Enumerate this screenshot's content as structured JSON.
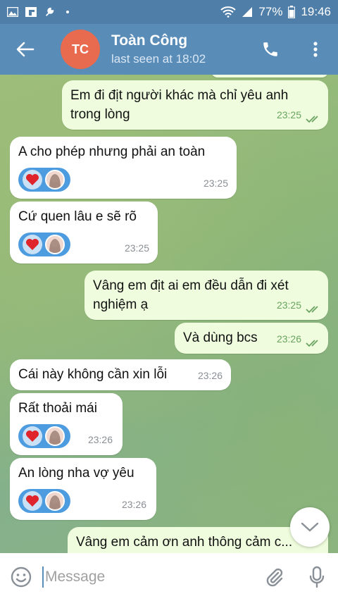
{
  "status_bar": {
    "battery_percent": "77%",
    "time": "19:46"
  },
  "header": {
    "avatar_initials": "TC",
    "contact_name": "Toàn Công",
    "last_seen": "last seen at 18:02"
  },
  "messages": [
    {
      "dir": "out",
      "text_lines": [
        "Em đi địt người khác mà chỉ yêu anh",
        "trong lòng"
      ],
      "time": "23:25"
    },
    {
      "dir": "in",
      "text_lines": [
        "A cho phép nhưng phải an toàn"
      ],
      "time": "23:25",
      "reaction": "heart"
    },
    {
      "dir": "in",
      "text_lines": [
        "Cứ quen lâu e sẽ rõ"
      ],
      "time": "23:25",
      "reaction": "heart"
    },
    {
      "dir": "out",
      "text_lines": [
        "Vâng em địt ai em đều dẫn đi xét",
        "nghiệm ạ"
      ],
      "time": "23:25"
    },
    {
      "dir": "out",
      "text_lines": [
        "Và dùng bcs"
      ],
      "time": "23:26"
    },
    {
      "dir": "in",
      "text_lines": [
        "Cái này không cần xin lỗi"
      ],
      "time": "23:26"
    },
    {
      "dir": "in",
      "text_lines": [
        "Rất thoải mái"
      ],
      "time": "23:26",
      "reaction": "heart"
    },
    {
      "dir": "in",
      "text_lines": [
        "An lòng nha vợ yêu"
      ],
      "time": "23:26",
      "reaction": "heart"
    },
    {
      "dir": "out",
      "text_lines": [
        "Vâng em cảm ơn anh thông cảm c..."
      ],
      "time": ""
    }
  ],
  "input": {
    "placeholder": "Message"
  },
  "colors": {
    "header": "#5a8cb8",
    "outgoing_bubble": "#effdde",
    "incoming_bubble": "#ffffff",
    "reaction_pill": "#4e9ce0",
    "avatar": "#e86b4f"
  }
}
